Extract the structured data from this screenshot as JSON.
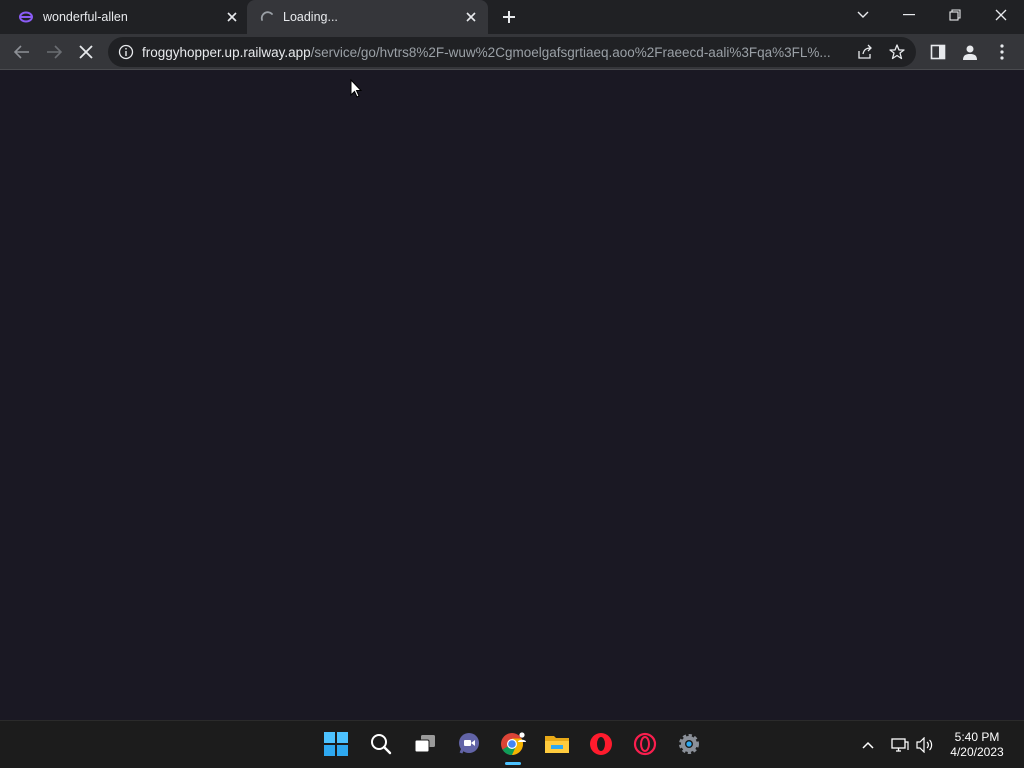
{
  "tabs": [
    {
      "title": "wonderful-allen",
      "icon": "railway-logo-icon"
    },
    {
      "title": "Loading...",
      "icon": "loading-spinner-icon"
    }
  ],
  "address_bar": {
    "host": "froggyhopper.up.railway.app",
    "path": "/service/go/hvtrs8%2F-wuw%2Cgmoelgafsgrtiaeq.aoo%2Fraeecd-aali%3Fqa%3FL%..."
  },
  "taskbar": {
    "apps": [
      "windows-start-icon",
      "search-icon",
      "task-view-icon",
      "teams-chat-icon",
      "chrome-icon",
      "file-explorer-icon",
      "opera-icon",
      "opera-gx-icon",
      "settings-icon"
    ],
    "active_app": "chrome-icon"
  },
  "clock": {
    "time": "5:40 PM",
    "date": "4/20/2023"
  },
  "colors": {
    "content_bg": "#1a1823",
    "chrome_dark": "#202124",
    "chrome_toolbar": "#35363a",
    "accent": "#4cc2ff"
  }
}
